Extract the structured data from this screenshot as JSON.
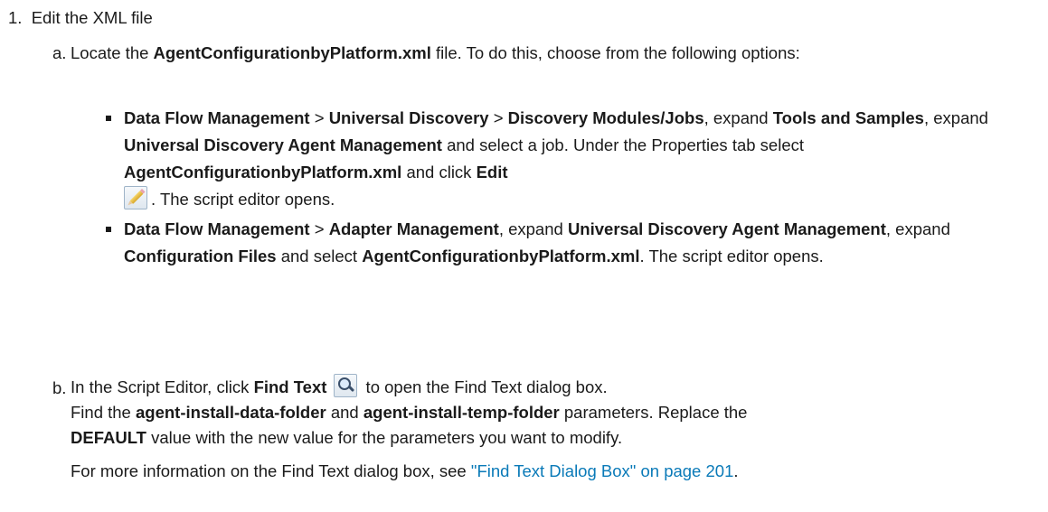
{
  "step1": {
    "number": "1.",
    "title": "Edit the XML file"
  },
  "step_a": {
    "marker": "a.",
    "t1": "Locate the ",
    "b1": "AgentConfigurationbyPlatform.xml",
    "t2": " file. To do this, choose from the following options:"
  },
  "bullet1": {
    "b1": "Data Flow Management",
    "s1": " > ",
    "b2": "Universal Discovery",
    "s2": " > ",
    "b3": "Discovery Modules/Jobs",
    "t1": ", expand ",
    "b4": "Tools and Samples",
    "t2": ", expand ",
    "b5": "Universal Discovery Agent Management",
    "t3": " and select a job. Under the Properties tab select ",
    "b6": "AgentConfigurationbyPlatform.xml",
    "t4": " and click ",
    "b7": "Edit",
    "icon": "edit-pencil-icon",
    "t5": ". The script editor opens."
  },
  "bullet2": {
    "b1": "Data Flow Management",
    "s1": " > ",
    "b2": "Adapter Management",
    "t1": ", expand ",
    "b3": "Universal Discovery Agent Management",
    "t2": ", expand ",
    "b4": "Configuration Files",
    "t3": " and select ",
    "b5": "AgentConfigurationbyPlatform.xml",
    "t4": ". The script editor opens."
  },
  "step_b": {
    "marker": "b.",
    "t1": "In the Script Editor, click ",
    "b1": "Find Text",
    "icon": "find-text-icon",
    "t2": " to open the Find Text dialog box.",
    "t3": "Find the ",
    "b2": "agent-install-data-folder",
    "t4": " and ",
    "b3": "agent-install-temp-folder",
    "t5": " parameters. Replace the ",
    "b4": "DEFAULT",
    "t6": " value with the new value for the parameters you want to modify.",
    "t7": "For more information on the Find Text dialog box, see ",
    "link": "\"Find Text Dialog Box\" on page 201",
    "t8": "."
  },
  "colors": {
    "link": "#0a7ab8",
    "text": "#1a1a1a"
  }
}
